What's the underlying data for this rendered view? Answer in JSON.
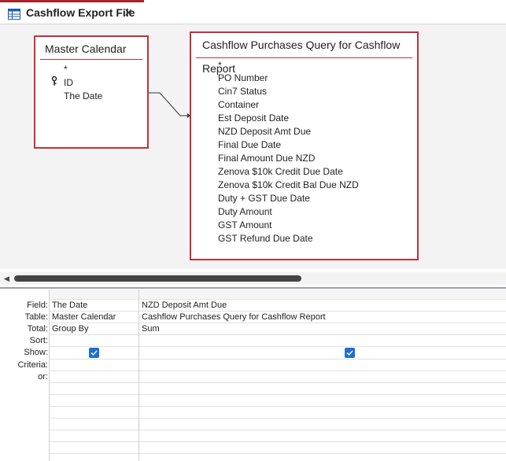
{
  "tab": {
    "title": "Cashflow Export File",
    "close": "×",
    "icon": "query-design-icon"
  },
  "tables": {
    "master_calendar": {
      "title": "Master Calendar",
      "fields": [
        "*",
        "ID",
        "The Date"
      ],
      "key_field": "ID"
    },
    "cashflow_purchases": {
      "title": "Cashflow Purchases Query for Cashflow Report",
      "fields": [
        "*",
        "PO Number",
        "Cin7 Status",
        "Container",
        "Est Deposit Date",
        "NZD Deposit Amt Due",
        "Final Due Date",
        "Final Amount Due NZD",
        "Zenova $10k Credit Due Date",
        "Zenova $10k Credit Bal Due NZD",
        "Duty + GST Due Date",
        "Duty Amount",
        "GST Amount",
        "GST Refund Due Date"
      ]
    }
  },
  "grid": {
    "row_labels": [
      "Field:",
      "Table:",
      "Total:",
      "Sort:",
      "Show:",
      "Criteria:",
      "or:"
    ],
    "columns": [
      {
        "field": "The Date",
        "table": "Master Calendar",
        "total": "Group By",
        "sort": "",
        "show": true
      },
      {
        "field": "NZD Deposit Amt Due",
        "table": "Cashflow Purchases Query for Cashflow Report",
        "total": "Sum",
        "sort": "",
        "show": true
      }
    ]
  },
  "colors": {
    "accent": "#c4313b",
    "checkbox": "#1f6fd1"
  }
}
